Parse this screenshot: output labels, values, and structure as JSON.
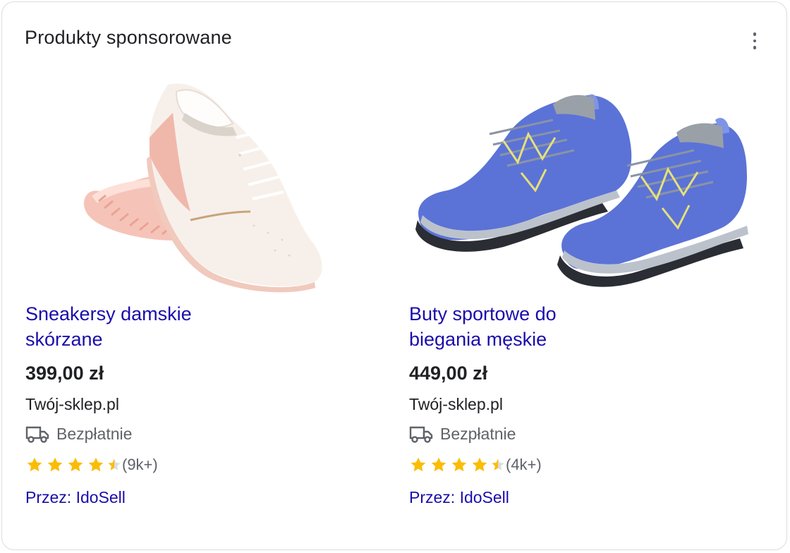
{
  "header": {
    "title": "Produkty sponsorowane",
    "menu_icon": "more-vert-icon"
  },
  "colors": {
    "link": "#1a0dab",
    "star": "#fbbc04",
    "star_empty": "#dadce0",
    "text": "#202124",
    "muted": "#5f6368"
  },
  "products": [
    {
      "title_line1": "Sneakersy damskie",
      "title_line2": "skórzane",
      "price": "399,00 zł",
      "store": "Twój-sklep.pl",
      "shipping": "Bezpłatnie",
      "rating": 4.5,
      "reviews": "(9k+)",
      "seller": "Przez: IdoSell",
      "image_icon": "white-sneaker-image"
    },
    {
      "title_line1": "Buty sportowe do",
      "title_line2": "biegania męskie",
      "price": "449,00 zł",
      "store": "Twój-sklep.pl",
      "shipping": "Bezpłatnie",
      "rating": 4.5,
      "reviews": "(4k+)",
      "seller": "Przez: IdoSell",
      "image_icon": "blue-running-shoes-image"
    }
  ]
}
